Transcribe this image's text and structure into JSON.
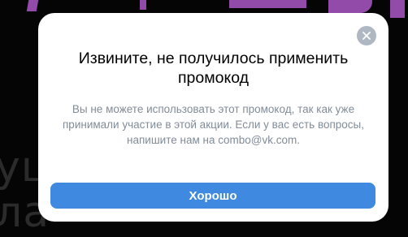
{
  "background": {
    "text_line_1": "уш",
    "text_line_2": "ла"
  },
  "dialog": {
    "title": "Извините, не получилось применить промокод",
    "message": "Вы не можете использовать этот промокод, так как уже принимали участие в этой акции. Если у вас есть вопросы, напишите нам на combo@vk.com.",
    "close_icon": "close-icon",
    "primary_button_label": "Хорошо"
  },
  "colors": {
    "overlay": "#050505",
    "background_accent": "#9b4fb3",
    "dialog_background": "#ffffff",
    "title": "#000000",
    "message": "#818c99",
    "close_button": "#aeb7c2",
    "primary_button": "#3f8ae0",
    "primary_button_text": "#ffffff"
  }
}
